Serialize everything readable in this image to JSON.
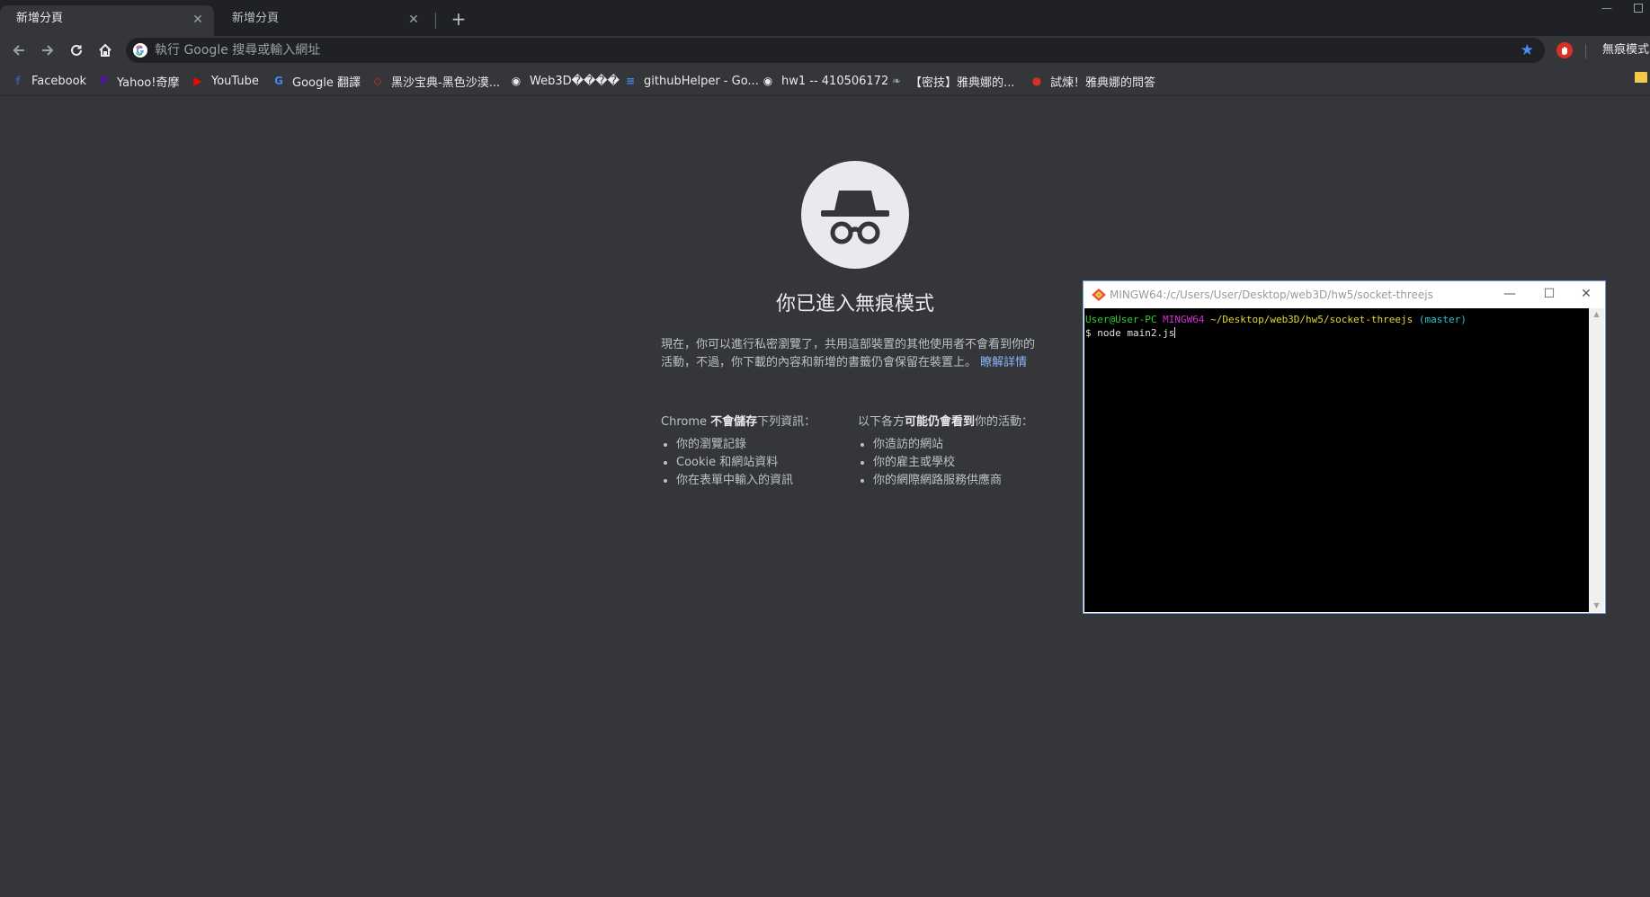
{
  "browser": {
    "tabs": [
      {
        "label": "新增分頁",
        "active": true
      },
      {
        "label": "新增分頁",
        "active": false
      }
    ],
    "new_tab_glyph": "+",
    "close_glyph": "✕",
    "window_minimize_glyph": "—",
    "omnibox": {
      "placeholder": "執行 Google 搜尋或輸入網址",
      "value": ""
    },
    "incognito_label": "無痕模式",
    "bookmarks": [
      {
        "label": "Facebook",
        "icon": "facebook-icon",
        "glyph": "f",
        "color": "#3b5998"
      },
      {
        "label": "Yahoo!奇摩",
        "icon": "yahoo-icon",
        "glyph": "Y",
        "color": "#5f01d1"
      },
      {
        "label": "YouTube",
        "icon": "youtube-icon",
        "glyph": "▶",
        "color": "#ff0000"
      },
      {
        "label": "Google 翻譯",
        "icon": "google-translate-icon",
        "glyph": "G",
        "color": "#4285f4"
      },
      {
        "label": "黑沙宝典-黑色沙漠...",
        "icon": "diamond-icon",
        "glyph": "◇",
        "color": "#d93025"
      },
      {
        "label": "Web3D����",
        "icon": "globe-icon",
        "glyph": "◉",
        "color": "#e8eaed"
      },
      {
        "label": "githubHelper - Go...",
        "icon": "google-docs-icon",
        "glyph": "≡",
        "color": "#4285f4"
      },
      {
        "label": "hw1 -- 410506172",
        "icon": "globe-icon",
        "glyph": "◉",
        "color": "#e8eaed"
      },
      {
        "label": "【密技】雅典娜的...",
        "icon": "feather-icon",
        "glyph": "❧",
        "color": "#9aa0a6"
      },
      {
        "label": "試煉！雅典娜的問答",
        "icon": "ladybug-icon",
        "glyph": "●",
        "color": "#d93025"
      }
    ]
  },
  "incognito": {
    "title": "你已進入無痕模式",
    "intro": "現在，你可以進行私密瀏覽了，共用這部裝置的其他使用者不會看到你的活動，不過，你下載的內容和新增的書籤仍會保留在裝置上。",
    "learn_more": "瞭解詳情",
    "not_saved": {
      "prefix": "Chrome ",
      "bold": "不會儲存",
      "suffix": "下列資訊：",
      "items": [
        "你的瀏覽記錄",
        "Cookie 和網站資料",
        "你在表單中輸入的資訊"
      ]
    },
    "may_be_visible": {
      "prefix": "以下各方",
      "bold": "可能仍會看到",
      "suffix": "你的活動：",
      "items": [
        "你造訪的網站",
        "你的雇主或學校",
        "你的網際網路服務供應商"
      ]
    }
  },
  "terminal": {
    "title": "MINGW64:/c/Users/User/Desktop/web3D/hw5/socket-threejs",
    "controls": {
      "minimize": "—",
      "maximize": "☐",
      "close": "✕"
    },
    "prompt": {
      "user_host": "User@User-PC",
      "system": "MINGW64",
      "path": "~/Desktop/web3D/hw5/socket-threejs",
      "branch": "(master)"
    },
    "command_line": "$ node main2.js",
    "colors": {
      "user": "#2ed12e",
      "system": "#d42fd4",
      "path": "#e5d62c",
      "branch": "#27c5d6"
    }
  },
  "theme": {
    "page_bg": "#35363a",
    "tabstrip_bg": "#202124",
    "accent_blue": "#8ab4f8"
  }
}
